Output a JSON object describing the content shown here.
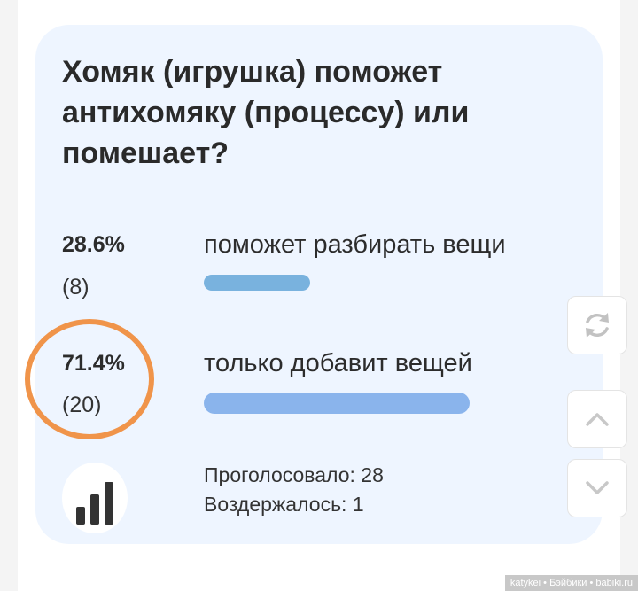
{
  "poll": {
    "question": "Хомяк (игрушка) поможет антихомяку (процессу) или помешает?",
    "options": [
      {
        "percent": "28.6%",
        "votes": "(8)",
        "label": "поможет разбирать вещи",
        "share": 0.286,
        "bar_color": "#79b2de"
      },
      {
        "percent": "71.4%",
        "votes": "(20)",
        "label": "только добавит вещей",
        "share": 0.714,
        "bar_color": "#8ab4ec"
      }
    ],
    "voted": "Проголосовало: 28",
    "abstained": "Воздержалось: 1"
  },
  "colors": {
    "card_background": "#eef5ff",
    "highlight_ring": "#f0944a",
    "stats_icon": "#333333"
  },
  "side_buttons": [
    {
      "icon": "refresh-icon"
    },
    {
      "icon": "chevron-up-icon"
    },
    {
      "icon": "chevron-down-icon"
    }
  ],
  "watermark": "katykei • Бэйбики • babiki.ru"
}
